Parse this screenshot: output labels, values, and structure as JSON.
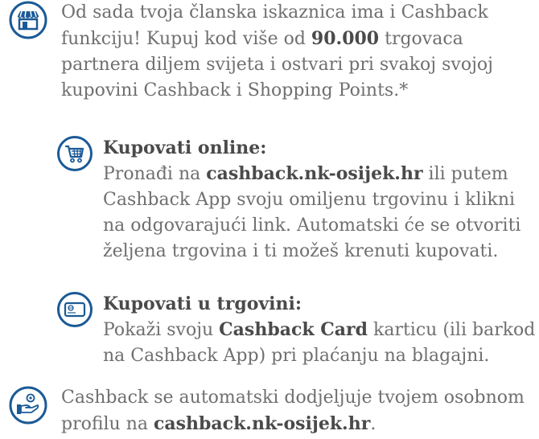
{
  "intro": {
    "text_before": "Od sada tvoja članska iskaznica ima i Cashback funkciju! Kupuj kod više od ",
    "highlight": "90.000",
    "text_after": " trgovaca partnera diljem svijeta i ostvari pri svakoj svojoj kupovini Cashback i Shopping Points.*",
    "icon": "storefront-icon"
  },
  "online": {
    "heading": "Kupovati online:",
    "text_before": "Pronađi na ",
    "link": "cashback.nk-osijek.hr",
    "text_after": " ili putem Cashback App svoju omiljenu trgovinu i klikni na odgovarajući link. Automatski će se otvoriti željena trgovina i ti možeš krenuti kupovati.",
    "icon": "shopping-cart-icon"
  },
  "store": {
    "heading": "Kupovati u trgovini:",
    "text_before": "Pokaži svoju ",
    "highlight": "Cashback Card",
    "text_after": " karticu (ili barkod na Cashback App) pri plaćanju na blagajni.",
    "icon": "card-icon"
  },
  "footer": {
    "text_before": "Cashback se automatski dodjeljuje tvojem osobnom profilu na ",
    "link": "cashback.nk-osijek.hr",
    "text_after": ".",
    "icon": "hand-coin-icon"
  },
  "colors": {
    "icon_blue": "#1b5a96",
    "text": "#6f6f6f",
    "bold_text": "#4a4a4a"
  }
}
